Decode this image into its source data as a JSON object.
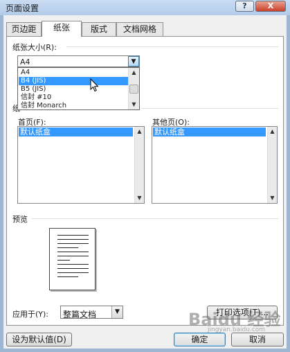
{
  "window": {
    "title": "页面设置",
    "help_label": "?",
    "close_label": "X"
  },
  "tabs": [
    {
      "label": "页边距"
    },
    {
      "label": "纸张"
    },
    {
      "label": "版式"
    },
    {
      "label": "文档网格"
    }
  ],
  "paper_size": {
    "label": "纸张大小(R):",
    "value": "A4",
    "options": [
      "A4",
      "B4 (JIS)",
      "B5 (JIS)",
      "信封 #10",
      "信封 Monarch"
    ],
    "selected_option": "B4 (JIS)"
  },
  "paper_source": {
    "label_visible": "纸",
    "first_page": {
      "label": "首页(F):",
      "items": [
        "默认纸盒"
      ]
    },
    "other_pages": {
      "label": "其他页(O):",
      "items": [
        "默认纸盒"
      ]
    }
  },
  "preview": {
    "label": "预览",
    "apply_to_label": "应用于(Y):",
    "apply_to_value": "整篇文档",
    "print_options_label": "打印选项(T)..."
  },
  "footer": {
    "set_default_label": "设为默认值(D)",
    "ok_label": "确定",
    "cancel_label": "取消"
  },
  "watermark": {
    "text": "Baidu 经验",
    "subtext": "jingyan.baidu.com"
  },
  "icons": {
    "combo_arrow": "▼",
    "scroll_up": "▲",
    "scroll_down": "▼",
    "list_scroll_up": "▲",
    "list_scroll_down": "▼",
    "cursor": "mouse-pointer-icon"
  }
}
